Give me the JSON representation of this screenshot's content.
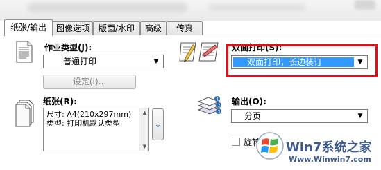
{
  "tabs": [
    {
      "label": "纸张/输出"
    },
    {
      "label": "图像选项"
    },
    {
      "label": "版面/水印"
    },
    {
      "label": "高级"
    },
    {
      "label": "传真"
    }
  ],
  "job_type": {
    "label": "作业类型(J):",
    "value": "普通打印",
    "settings_button": "设定(I)..."
  },
  "paper": {
    "label": "纸张(R):",
    "size_line": "尺寸: A4(210x297mm)",
    "type_line": "类型: 打印机默认类型"
  },
  "duplex": {
    "label": "双面打印(S):",
    "value": "双面打印，长边装订"
  },
  "output": {
    "label": "输出(O):",
    "value": "分页"
  },
  "rotate": {
    "label": "旋转"
  },
  "watermark": {
    "brand": "Win7系统之家",
    "url": "Www.Winwin7.com"
  },
  "colors": {
    "highlight": "#3399ff",
    "red_frame": "#e3101a"
  }
}
